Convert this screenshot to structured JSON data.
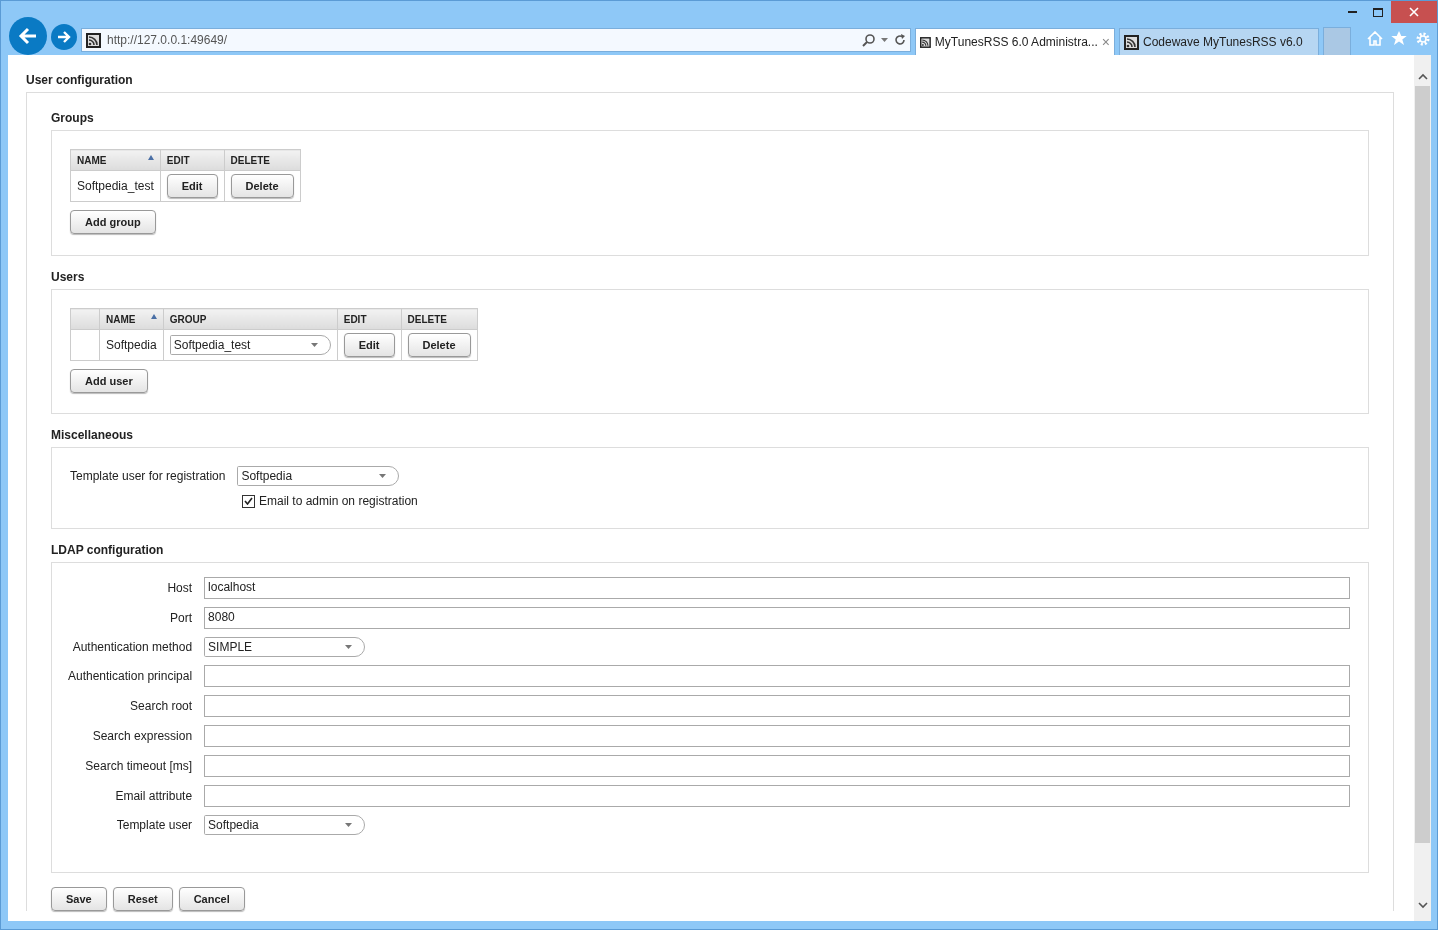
{
  "browser": {
    "url": "http://127.0.0.1:49649/",
    "tabs": [
      {
        "title": "MyTunesRSS 6.0 Administra...",
        "selected": true,
        "close": "×"
      },
      {
        "title": "Codewave MyTunesRSS v6.0",
        "selected": false
      }
    ]
  },
  "page": {
    "title": "User configuration",
    "groups": {
      "heading": "Groups",
      "columns": [
        {
          "label": "NAME",
          "sorted": true
        },
        {
          "label": "EDIT",
          "sorted": false
        },
        {
          "label": "DELETE",
          "sorted": false
        }
      ],
      "rows": [
        {
          "name": "Softpedia_test",
          "edit": "Edit",
          "delete": "Delete"
        }
      ],
      "add": "Add group"
    },
    "users": {
      "heading": "Users",
      "columns": [
        {
          "label": "NAME",
          "sorted": true
        },
        {
          "label": "GROUP",
          "sorted": false
        },
        {
          "label": "EDIT",
          "sorted": false
        },
        {
          "label": "DELETE",
          "sorted": false
        }
      ],
      "rows": [
        {
          "name": "Softpedia",
          "group": "Softpedia_test",
          "edit": "Edit",
          "delete": "Delete"
        }
      ],
      "add": "Add user"
    },
    "misc": {
      "heading": "Miscellaneous",
      "template_label": "Template user for registration",
      "template_value": "Softpedia",
      "email_label": "Email to admin on registration",
      "email_checked": true
    },
    "ldap": {
      "heading": "LDAP configuration",
      "fields": [
        {
          "kind": "text",
          "label": "Host",
          "value": "localhost"
        },
        {
          "kind": "text",
          "label": "Port",
          "value": "8080"
        },
        {
          "kind": "select",
          "label": "Authentication method",
          "value": "SIMPLE"
        },
        {
          "kind": "text",
          "label": "Authentication principal"
        },
        {
          "kind": "text",
          "label": "Search root"
        },
        {
          "kind": "text",
          "label": "Search expression"
        },
        {
          "kind": "text",
          "label": "Search timeout [ms]"
        },
        {
          "kind": "text",
          "label": "Email attribute"
        },
        {
          "kind": "select",
          "label": "Template user",
          "value": "Softpedia"
        }
      ]
    },
    "buttons": [
      "Save",
      "Reset",
      "Cancel"
    ]
  }
}
